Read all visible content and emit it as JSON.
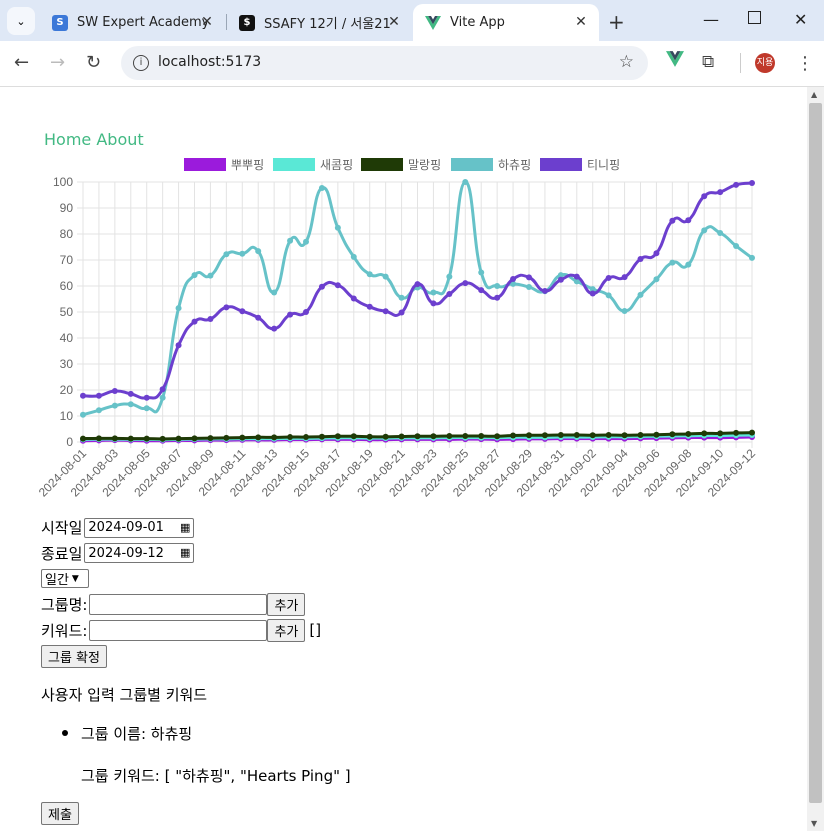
{
  "browser": {
    "tabs": [
      {
        "title": "SW Expert Academy",
        "icon": "sw-expert-academy-icon",
        "color": "#3c78d8"
      },
      {
        "title": "SSAFY 12기 / 서울21",
        "icon": "notion-icon",
        "color": "#111111"
      },
      {
        "title": "Vite App",
        "icon": "vue-icon",
        "color": "#42b983"
      }
    ],
    "url": "localhost:5173",
    "profile_initial": "지용"
  },
  "nav": {
    "home": "Home",
    "about": "About"
  },
  "chart_data": {
    "type": "line",
    "title": "",
    "legend_position": "top",
    "ylim": [
      0,
      100
    ],
    "yticks": [
      0,
      10,
      20,
      30,
      40,
      50,
      60,
      70,
      80,
      90,
      100
    ],
    "x": [
      "2024-08-01",
      "2024-08-02",
      "2024-08-03",
      "2024-08-04",
      "2024-08-05",
      "2024-08-06",
      "2024-08-07",
      "2024-08-08",
      "2024-08-09",
      "2024-08-10",
      "2024-08-11",
      "2024-08-12",
      "2024-08-13",
      "2024-08-14",
      "2024-08-15",
      "2024-08-16",
      "2024-08-17",
      "2024-08-18",
      "2024-08-19",
      "2024-08-20",
      "2024-08-21",
      "2024-08-22",
      "2024-08-23",
      "2024-08-24",
      "2024-08-25",
      "2024-08-26",
      "2024-08-27",
      "2024-08-28",
      "2024-08-29",
      "2024-08-30",
      "2024-08-31",
      "2024-09-01",
      "2024-09-02",
      "2024-09-03",
      "2024-09-04",
      "2024-09-05",
      "2024-09-06",
      "2024-09-07",
      "2024-09-08",
      "2024-09-09",
      "2024-09-10",
      "2024-09-11",
      "2024-09-12"
    ],
    "xticklabels": [
      "2024-08-01",
      "2024-08-03",
      "2024-08-05",
      "2024-08-07",
      "2024-08-09",
      "2024-08-11",
      "2024-08-13",
      "2024-08-15",
      "2024-08-17",
      "2024-08-19",
      "2024-08-21",
      "2024-08-23",
      "2024-08-25",
      "2024-08-27",
      "2024-08-29",
      "2024-08-31",
      "2024-09-02",
      "2024-09-04",
      "2024-09-06",
      "2024-09-08",
      "2024-09-10",
      "2024-09-12"
    ],
    "series": [
      {
        "name": "뿌뿌핑",
        "color": "#9b1bdc",
        "values": [
          0.5,
          0.6,
          0.7,
          0.6,
          0.5,
          0.5,
          0.6,
          0.6,
          0.7,
          0.7,
          0.8,
          0.8,
          0.8,
          0.9,
          0.9,
          1.0,
          1.0,
          1.0,
          0.9,
          0.9,
          1.0,
          1.0,
          1.0,
          1.0,
          1.1,
          1.1,
          1.0,
          1.1,
          1.2,
          1.2,
          1.3,
          1.3,
          1.3,
          1.3,
          1.3,
          1.4,
          1.5,
          1.6,
          1.7,
          1.7,
          1.7,
          1.8,
          1.9
        ]
      },
      {
        "name": "새콤핑",
        "color": "#5ae8d6",
        "values": [
          1.0,
          1.1,
          1.1,
          1.0,
          1.0,
          0.9,
          1.0,
          1.1,
          1.2,
          1.2,
          1.3,
          1.3,
          1.3,
          1.4,
          1.4,
          1.5,
          1.6,
          1.6,
          1.5,
          1.5,
          1.6,
          1.6,
          1.6,
          1.7,
          1.7,
          1.7,
          1.7,
          1.8,
          1.8,
          1.8,
          1.9,
          1.9,
          1.9,
          2.0,
          2.0,
          2.1,
          2.2,
          2.3,
          2.4,
          2.5,
          2.5,
          2.6,
          2.7
        ]
      },
      {
        "name": "말랑핑",
        "color": "#1f3a06",
        "values": [
          1.3,
          1.4,
          1.4,
          1.3,
          1.3,
          1.2,
          1.3,
          1.4,
          1.5,
          1.6,
          1.7,
          1.8,
          1.8,
          1.9,
          1.9,
          2.0,
          2.2,
          2.2,
          2.0,
          2.0,
          2.1,
          2.2,
          2.2,
          2.3,
          2.3,
          2.3,
          2.2,
          2.5,
          2.6,
          2.6,
          2.7,
          2.7,
          2.6,
          2.7,
          2.6,
          2.7,
          2.8,
          3.0,
          3.1,
          3.3,
          3.3,
          3.5,
          3.6
        ]
      },
      {
        "name": "하츄핑",
        "color": "#66c2c8",
        "values": [
          10.5,
          12.2,
          14.0,
          14.5,
          13.0,
          17.0,
          51.5,
          64.2,
          64.0,
          72.2,
          72.4,
          73.4,
          57.5,
          77.4,
          77.0,
          97.7,
          82.4,
          71.2,
          64.5,
          63.6,
          55.5,
          59.4,
          57.5,
          63.6,
          100,
          65.2,
          60.0,
          60.8,
          59.6,
          58.0,
          64.2,
          61.8,
          58.8,
          56.4,
          50.4,
          56.6,
          62.6,
          69.0,
          68.2,
          81.4,
          80.4,
          75.4,
          70.8
        ]
      },
      {
        "name": "티니핑",
        "color": "#6c3fce",
        "values": [
          17.8,
          17.8,
          19.6,
          18.5,
          17.0,
          20.3,
          37.2,
          46.3,
          47.3,
          51.8,
          50.3,
          47.8,
          43.6,
          49.0,
          50.0,
          59.7,
          60.3,
          55.2,
          52.0,
          50.3,
          49.8,
          60.7,
          53.3,
          56.9,
          61.1,
          58.4,
          55.5,
          62.7,
          63.3,
          58.1,
          62.4,
          63.6,
          57.1,
          63.1,
          63.4,
          70.4,
          72.6,
          85.1,
          85.3,
          94.5,
          96.1,
          98.9,
          99.6
        ]
      }
    ]
  },
  "form": {
    "start_label": "시작일",
    "start_value": "2024-09-01",
    "end_label": "종료일",
    "end_value": "2024-09-12",
    "period_value": "일간",
    "group_label": "그룹명:",
    "add_label": "추가",
    "keyword_label": "키워드:",
    "keyword_list": "[]",
    "confirm_label": "그룹 확정"
  },
  "summary": {
    "title": "사용자 입력 그룹별 키워드",
    "group_name_line": "그룹 이름: 하츄핑",
    "group_keywords_line": "그룹 키워드: [ \"하츄핑\", \"Hearts Ping\" ]",
    "submit_label": "제출"
  }
}
